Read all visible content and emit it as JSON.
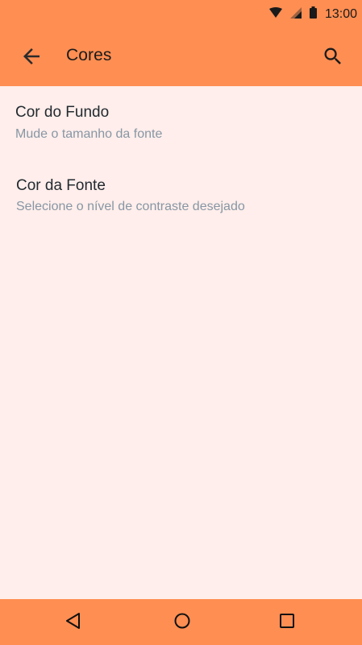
{
  "status_bar": {
    "time": "13:00",
    "icons": [
      "wifi-icon",
      "cell-signal-icon",
      "battery-icon"
    ]
  },
  "app_bar": {
    "title": "Cores",
    "back_icon": "arrow-back-icon",
    "search_icon": "search-icon"
  },
  "preferences": [
    {
      "title": "Cor do Fundo",
      "summary": "Mude o tamanho da fonte"
    },
    {
      "title": "Cor da Fonte",
      "summary": "Selecione o nível de contraste desejado"
    }
  ],
  "nav_bar": {
    "icons": [
      "nav-back-icon",
      "nav-home-icon",
      "nav-recents-icon"
    ]
  },
  "colors": {
    "accent": "#FF8E52",
    "background": "#FFEEEB",
    "title_text": "#222A30",
    "summary_text": "#8796A4"
  }
}
